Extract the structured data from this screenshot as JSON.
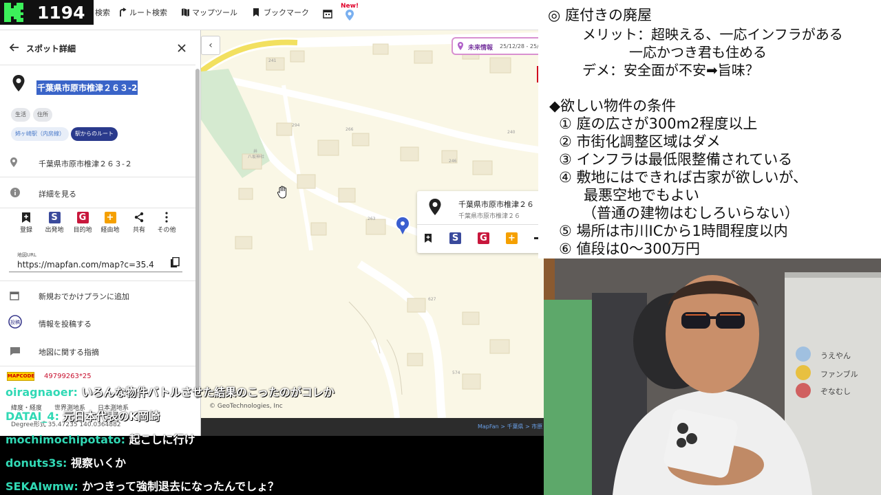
{
  "counter": {
    "value": "1194"
  },
  "toolbar": {
    "items": [
      {
        "label": "検索",
        "icon": "search-icon"
      },
      {
        "label": "ルート検索",
        "icon": "route-icon"
      },
      {
        "label": "マップツール",
        "icon": "map-icon"
      },
      {
        "label": "ブックマーク",
        "icon": "bookmark-icon"
      }
    ],
    "new_badge": "New!"
  },
  "panel": {
    "title": "スポット詳細",
    "address_title": "千葉県市原市椎津２６３-2",
    "chips": [
      "生活",
      "住所",
      "姉ヶ崎駅（内房線）",
      "駅からのルート"
    ],
    "address_row": "千葉県市原市椎津２６３-２",
    "details_row": "詳細を見る",
    "actions": [
      {
        "label": "登録",
        "icon": "bookmark-add-icon"
      },
      {
        "label": "出発地",
        "icon": "start-s-icon",
        "glyph": "S",
        "color": "#3a4a9c"
      },
      {
        "label": "目的地",
        "icon": "goal-g-icon",
        "glyph": "G",
        "color": "#c8173c"
      },
      {
        "label": "経由地",
        "icon": "waypoint-plus-icon",
        "glyph": "+",
        "color": "#f5a000"
      },
      {
        "label": "共有",
        "icon": "share-icon"
      },
      {
        "label": "その他",
        "icon": "more-icon"
      }
    ],
    "url_label": "地図URL",
    "url_value": "https://mapfan.com/map?c=35.4",
    "menu": [
      {
        "label": "新規おでかけプランに追加",
        "icon": "calendar-plan-icon"
      },
      {
        "label": "情報を投稿する",
        "icon": "post-icon"
      },
      {
        "label": "地図に関する指摘",
        "icon": "comment-icon"
      }
    ],
    "mapcode_logo": "MAPCODE",
    "mapcode": "49799263*25",
    "footer1": "緯度・経度　　世界測地系　　日本測地系",
    "footer2": "Degree形式  35.47235  140.0364882"
  },
  "map": {
    "info_pill_title": "未来情報",
    "info_pill_date": "25/12/28 - 25/",
    "popup_name": "千葉県市原市椎津２６",
    "popup_sub": "千葉県市原市椎津２６",
    "credit": "© GeoTechnologies, Inc",
    "breadcrumb": "MapFan > 千葉県 > 市原",
    "labels": [
      "241",
      "八坂神社",
      "294",
      "266",
      "246",
      "240",
      "263",
      "627",
      "574",
      "井"
    ]
  },
  "notes": {
    "lines": [
      "◎ 庭付きの廃屋",
      "メリット：超映える、一応インフラがある",
      "一応かつき君も住める",
      "デメ：安全面が不安➡旨味？",
      "◆欲しい物件の条件",
      "① 庭の広さが300m2程度以上",
      "② 市街化調整区域はダメ",
      "③ インフラは最低限整備されている",
      "④ 敷地にはできれば古家が欲しいが、",
      "最悪空地でもよい",
      "（普通の建物はむしろいらない）",
      "⑤ 場所は市川ICから1時間程度以内",
      "⑥ 値段は0～300万円"
    ]
  },
  "cam": {
    "labels": [
      "うえやん",
      "ファンブル",
      "ぞなむし"
    ]
  },
  "chat": [
    {
      "user": "oiragnaoer:",
      "msg": "いろんな物件バトルさせた結果のこったのがコレか"
    },
    {
      "user": "DATAI_4:",
      "msg": "元日本代表のK岡崎"
    },
    {
      "user": "mochimochipotato:",
      "msg": "起こしに行け"
    },
    {
      "user": "donuts3s:",
      "msg": "視察いくか"
    },
    {
      "user": "SEKAIwmw:",
      "msg": "かつきって強制退去になったんでしょ？"
    }
  ]
}
